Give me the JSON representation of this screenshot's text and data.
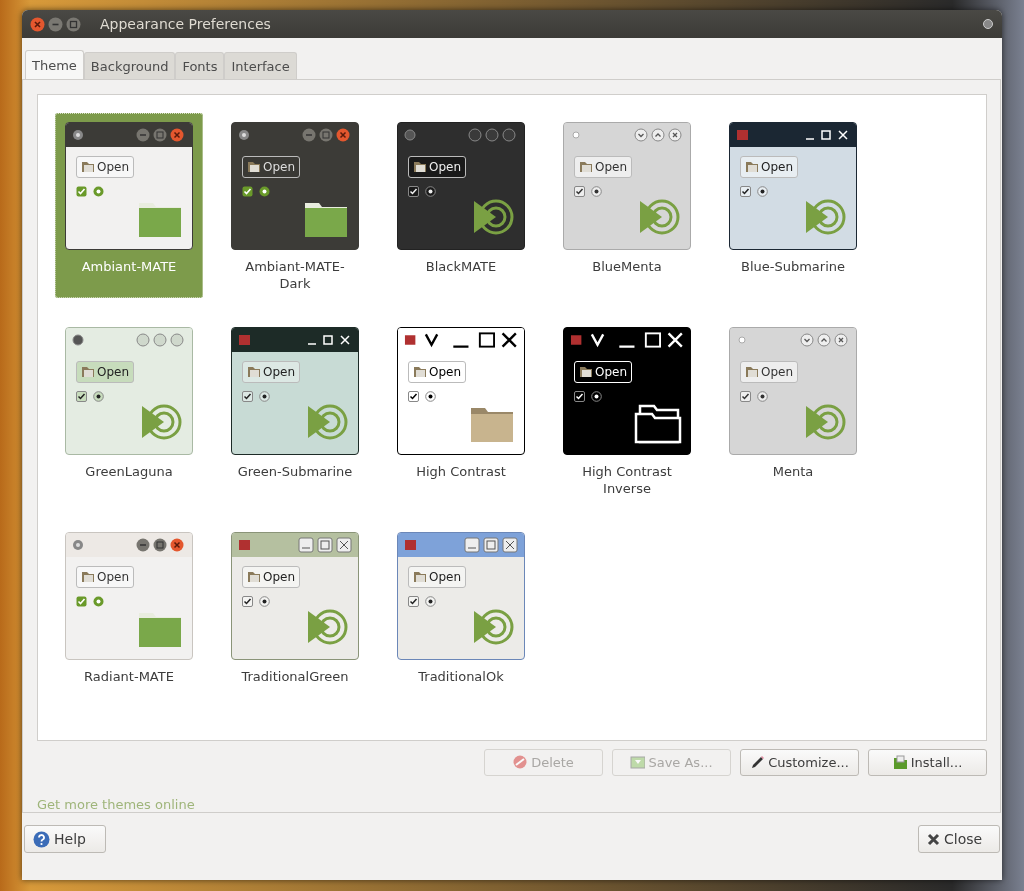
{
  "window": {
    "title": "Appearance Preferences"
  },
  "tabs": [
    {
      "label": "Theme",
      "selected": true
    },
    {
      "label": "Background",
      "selected": false
    },
    {
      "label": "Fonts",
      "selected": false
    },
    {
      "label": "Interface",
      "selected": false
    }
  ],
  "themes": [
    {
      "name": "Ambiant-MATE",
      "kind": "ambiant",
      "preview_button": "Open",
      "selected": true
    },
    {
      "name": "Ambiant-MATE-Dark",
      "kind": "ambiant-dark",
      "preview_button": "Open",
      "selected": false
    },
    {
      "name": "BlackMATE",
      "kind": "black",
      "preview_button": "Open",
      "selected": false
    },
    {
      "name": "BlueMenta",
      "kind": "bluementa",
      "preview_button": "Open",
      "selected": false
    },
    {
      "name": "Blue-Submarine",
      "kind": "blue-submarine",
      "preview_button": "Open",
      "selected": false
    },
    {
      "name": "GreenLaguna",
      "kind": "greenlaguna",
      "preview_button": "Open",
      "selected": false
    },
    {
      "name": "Green-Submarine",
      "kind": "green-submarine",
      "preview_button": "Open",
      "selected": false
    },
    {
      "name": "High Contrast",
      "kind": "high-contrast",
      "preview_button": "Open",
      "selected": false
    },
    {
      "name": "High Contrast Inverse",
      "kind": "high-contrast-inverse",
      "preview_button": "Open",
      "selected": false
    },
    {
      "name": "Menta",
      "kind": "menta",
      "preview_button": "Open",
      "selected": false
    },
    {
      "name": "Radiant-MATE",
      "kind": "radiant",
      "preview_button": "Open",
      "selected": false
    },
    {
      "name": "TraditionalGreen",
      "kind": "traditional-green",
      "preview_button": "Open",
      "selected": false
    },
    {
      "name": "TraditionalOk",
      "kind": "traditional-ok",
      "preview_button": "Open",
      "selected": false
    }
  ],
  "actions": [
    {
      "label": "Delete",
      "kind": "delete",
      "disabled": true
    },
    {
      "label": "Save As...",
      "kind": "save",
      "disabled": true
    },
    {
      "label": "Customize...",
      "kind": "customize",
      "disabled": false
    },
    {
      "label": "Install...",
      "kind": "install",
      "disabled": false
    }
  ],
  "link": "Get more themes online",
  "footer": {
    "help": "Help",
    "close": "Close"
  }
}
